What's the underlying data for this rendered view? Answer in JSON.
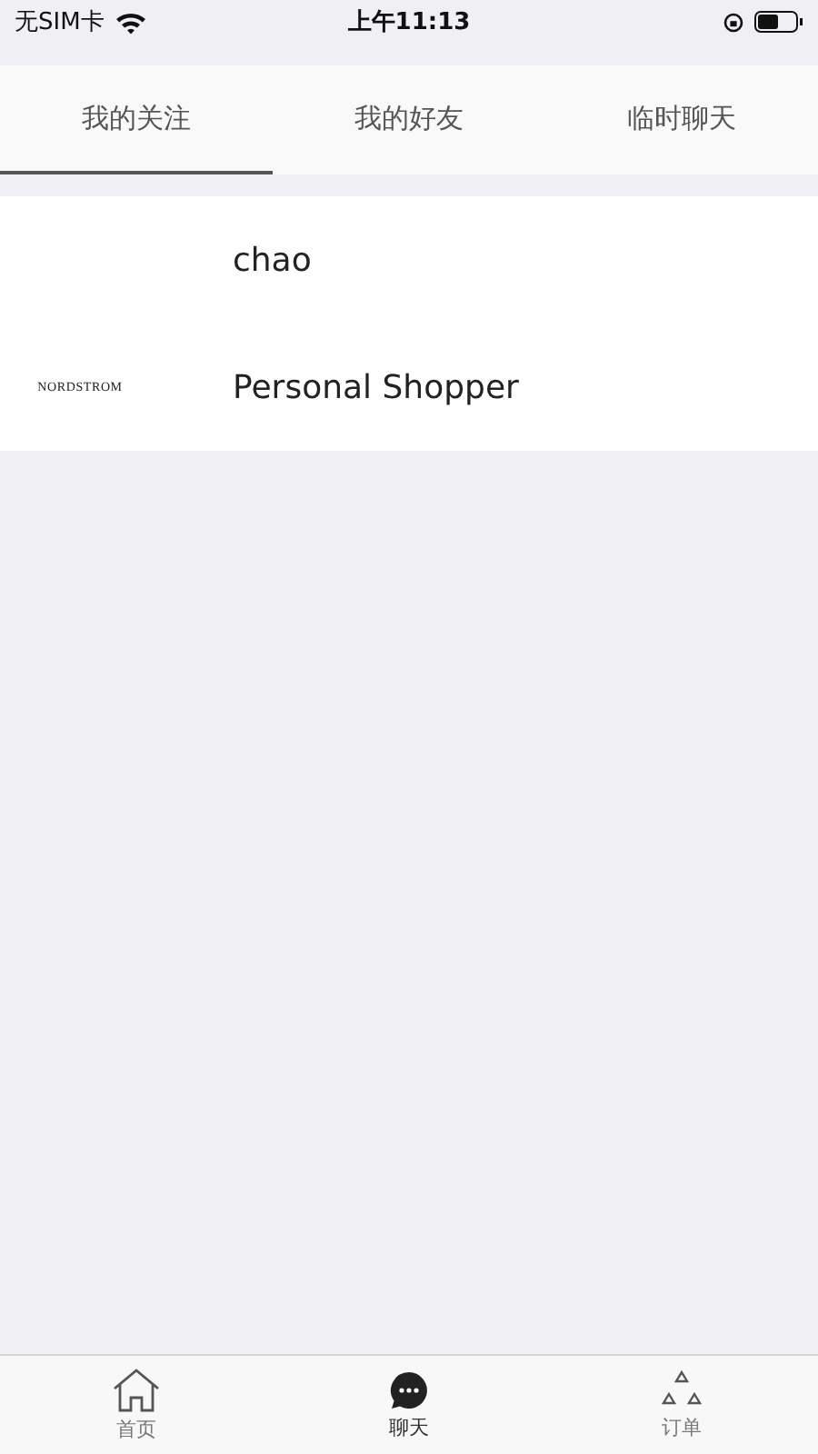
{
  "status_bar": {
    "carrier": "无SIM卡",
    "time": "上午11:13"
  },
  "tabs": [
    {
      "label": "我的关注",
      "selected": true
    },
    {
      "label": "我的好友",
      "selected": false
    },
    {
      "label": "临时聊天",
      "selected": false
    }
  ],
  "contacts": [
    {
      "name": "chao"
    },
    {
      "name": "Personal Shopper",
      "logo": "NORDSTROM"
    }
  ],
  "bottom_nav": [
    {
      "label": "首页",
      "kind": "home",
      "selected": false
    },
    {
      "label": "聊天",
      "kind": "chat",
      "selected": true
    },
    {
      "label": "订单",
      "kind": "order",
      "selected": false
    }
  ]
}
